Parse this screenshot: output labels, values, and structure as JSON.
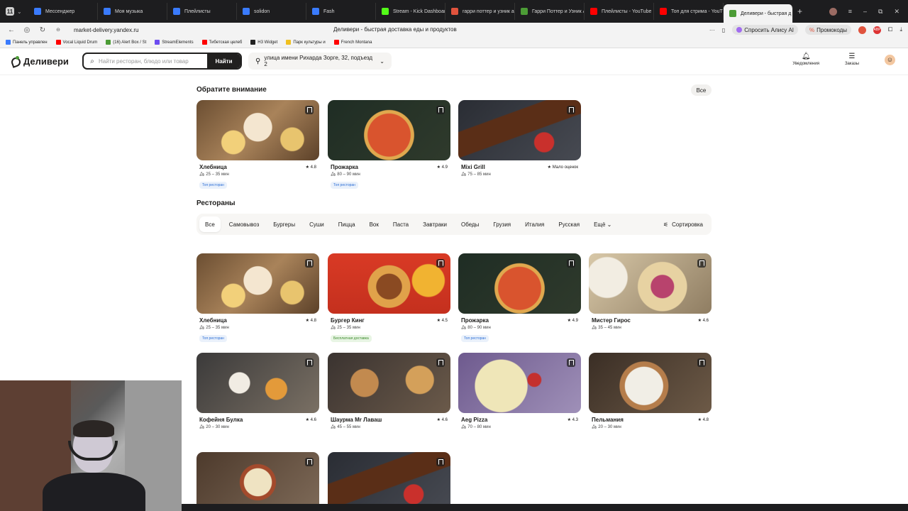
{
  "browser": {
    "tabs": [
      {
        "label": "Мессенджер",
        "color": "#3a7bfd"
      },
      {
        "label": "Моя музыка",
        "color": "#3a7bfd"
      },
      {
        "label": "Плейлисты",
        "color": "#3a7bfd"
      },
      {
        "label": "solidon",
        "color": "#3a7bfd"
      },
      {
        "label": "Fash",
        "color": "#3a7bfd"
      },
      {
        "label": "Stream - Kick Dashboard",
        "color": "#53fc18"
      },
      {
        "label": "гарри поттер и узник азк",
        "color": "#e0533d"
      },
      {
        "label": "Гарри Поттер и Узник Аз",
        "color": "#4c9c36"
      },
      {
        "label": "Плейлисты - YouTube",
        "color": "#ff0000"
      },
      {
        "label": "Топ для стрима - YouTube",
        "color": "#ff0000"
      },
      {
        "label": "Деливери - быстрая д",
        "color": "#4c9c36"
      }
    ],
    "tab_count_badge": "11",
    "url": "market-delivery.yandex.ru",
    "page_title": "Деливери - быстрая доставка еды и продуктов",
    "ask_alice": "Спросить Алису AI",
    "promocodes": "Промокоды",
    "ext_label": "ABP",
    "bookmarks": [
      {
        "label": "Панель управлен",
        "color": "#3a7bfd"
      },
      {
        "label": "Vocal Liquid Drum",
        "color": "#ff0000"
      },
      {
        "label": "(16) Alert Box / St",
        "color": "#4c9c36"
      },
      {
        "label": "StreamElements",
        "color": "#6c4cf0"
      },
      {
        "label": "Тибетская целеб",
        "color": "#ff0000"
      },
      {
        "label": "H3 Widget",
        "color": "#222222"
      },
      {
        "label": "Парк культуры и",
        "color": "#f0c020"
      },
      {
        "label": "French Montana",
        "color": "#ff0000"
      }
    ]
  },
  "header": {
    "logo": "Деливери",
    "search_placeholder": "Найти ресторан, блюдо или товар",
    "search_button": "Найти",
    "address": "улица имени Рихарда Зорге, 32, подъезд 2",
    "notifications": "Уведомления",
    "orders": "Заказы"
  },
  "attention": {
    "title": "Обратите внимание",
    "all_button": "Все",
    "cards": [
      {
        "name": "Хлебница",
        "rating": "★ 4.8",
        "time": "25 – 35 мин",
        "badge": "Топ ресторан",
        "badge_type": "top",
        "img": "bakery"
      },
      {
        "name": "Прожарка",
        "rating": "★ 4.9",
        "time": "80 – 90 мин",
        "badge": "Топ ресторан",
        "badge_type": "top",
        "img": "pizza"
      },
      {
        "name": "Mixi Grill",
        "rating": "★ Мало оценок",
        "time": "75 – 85 мин",
        "badge": "",
        "badge_type": "",
        "img": "kebab"
      }
    ]
  },
  "restaurants": {
    "title": "Рестораны",
    "filters": [
      "Все",
      "Самовывоз",
      "Бургеры",
      "Суши",
      "Пицца",
      "Вок",
      "Паста",
      "Завтраки",
      "Обеды",
      "Грузия",
      "Италия",
      "Русская",
      "Ещё"
    ],
    "sort_label": "Сортировка",
    "cards": [
      {
        "name": "Хлебница",
        "rating": "★ 4.8",
        "time": "25 – 35 мин",
        "badge": "Топ ресторан",
        "badge_type": "top",
        "img": "bakery"
      },
      {
        "name": "Бургер Кинг",
        "rating": "★ 4.5",
        "time": "25 – 35 мин",
        "badge": "Бесплатная доставка",
        "badge_type": "free",
        "img": "burger"
      },
      {
        "name": "Прожарка",
        "rating": "★ 4.9",
        "time": "80 – 90 мин",
        "badge": "Топ ресторан",
        "badge_type": "top",
        "img": "pizza"
      },
      {
        "name": "Мистер Гирос",
        "rating": "★ 4.6",
        "time": "35 – 45 мин",
        "badge": "",
        "badge_type": "",
        "img": "gyros"
      },
      {
        "name": "Кофейня Булка",
        "rating": "★ 4.6",
        "time": "20 – 30 мин",
        "badge": "",
        "badge_type": "",
        "img": "coffee"
      },
      {
        "name": "Шаурма Mr Лаваш",
        "rating": "★ 4.6",
        "time": "45 – 55 мин",
        "badge": "",
        "badge_type": "",
        "img": "shawarma"
      },
      {
        "name": "Aeg Pizza",
        "rating": "★ 4.3",
        "time": "70 – 80 мин",
        "badge": "",
        "badge_type": "",
        "img": "aegpizza"
      },
      {
        "name": "Пельмания",
        "rating": "★ 4.8",
        "time": "20 – 30 мин",
        "badge": "",
        "badge_type": "",
        "img": "pelmeni"
      },
      {
        "name": "",
        "rating": "",
        "time": "",
        "badge": "",
        "badge_type": "",
        "img": "wrap"
      },
      {
        "name": "",
        "rating": "",
        "time": "",
        "badge": "",
        "badge_type": "",
        "img": "kebab"
      }
    ]
  }
}
